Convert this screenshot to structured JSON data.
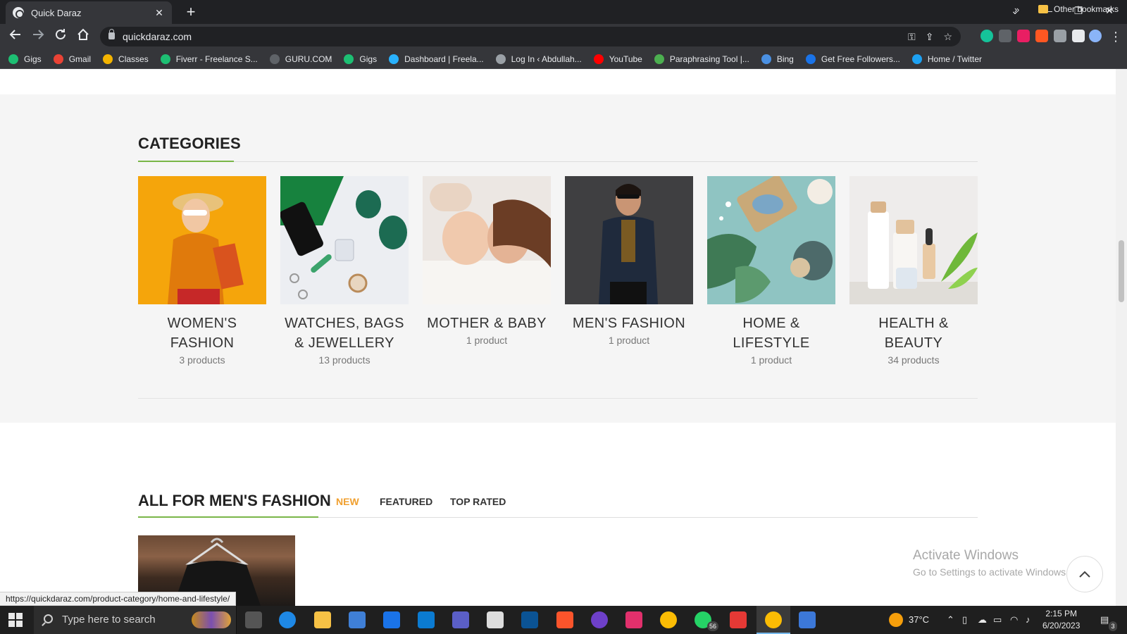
{
  "browser": {
    "tab_title": "Quick Daraz",
    "tab_close": "✕",
    "new_tab": "+",
    "url": "quickdaraz.com",
    "window_controls": [
      "⌄",
      "—",
      "❐",
      "✕"
    ],
    "bookmarks": [
      {
        "label": "Gigs",
        "icon_color": "#1dbf73"
      },
      {
        "label": "Gmail",
        "icon_color": "#ea4335"
      },
      {
        "label": "Classes",
        "icon_color": "#f4b400"
      },
      {
        "label": "Fiverr - Freelance S...",
        "icon_color": "#1dbf73"
      },
      {
        "label": "GURU.COM",
        "icon_color": "#5f6368"
      },
      {
        "label": "Gigs",
        "icon_color": "#1dbf73"
      },
      {
        "label": "Dashboard | Freela...",
        "icon_color": "#29b2fe"
      },
      {
        "label": "Log In ‹ Abdullah...",
        "icon_color": "#9aa0a6"
      },
      {
        "label": "YouTube",
        "icon_color": "#ff0000"
      },
      {
        "label": "Paraphrasing Tool |...",
        "icon_color": "#4caf50"
      },
      {
        "label": "Bing",
        "icon_color": "#4a90e2"
      },
      {
        "label": "Get Free Followers...",
        "icon_color": "#1a73e8"
      },
      {
        "label": "Home / Twitter",
        "icon_color": "#1da1f2"
      }
    ],
    "bookmarks_more": "»",
    "other_bookmarks": "Other bookmarks"
  },
  "page": {
    "categories_title": "CATEGORIES",
    "accent_color": "#7ab648",
    "categories": [
      {
        "name": "WOMEN'S FASHION",
        "count": "3 products"
      },
      {
        "name": "WATCHES, BAGS & JEWELLERY",
        "count": "13 products"
      },
      {
        "name": "MOTHER & BABY",
        "count": "1 product"
      },
      {
        "name": "MEN'S FASHION",
        "count": "1 product"
      },
      {
        "name": "HOME & LIFESTYLE",
        "count": "1 product"
      },
      {
        "name": "HEALTH & BEAUTY",
        "count": "34 products"
      }
    ],
    "mens_title": "ALL FOR MEN'S FASHION",
    "mens_tabs": [
      "NEW",
      "FEATURED",
      "TOP RATED"
    ],
    "mens_active_color": "#f0a030",
    "activate_title": "Activate Windows",
    "activate_sub": "Go to Settings to activate Windows.",
    "status_url": "https://quickdaraz.com/product-category/home-and-lifestyle/"
  },
  "taskbar": {
    "search_placeholder": "Type here to search",
    "weather": "37°C",
    "time": "2:15 PM",
    "date": "6/20/2023",
    "whatsapp_badge": "56",
    "notif_count": "3"
  }
}
